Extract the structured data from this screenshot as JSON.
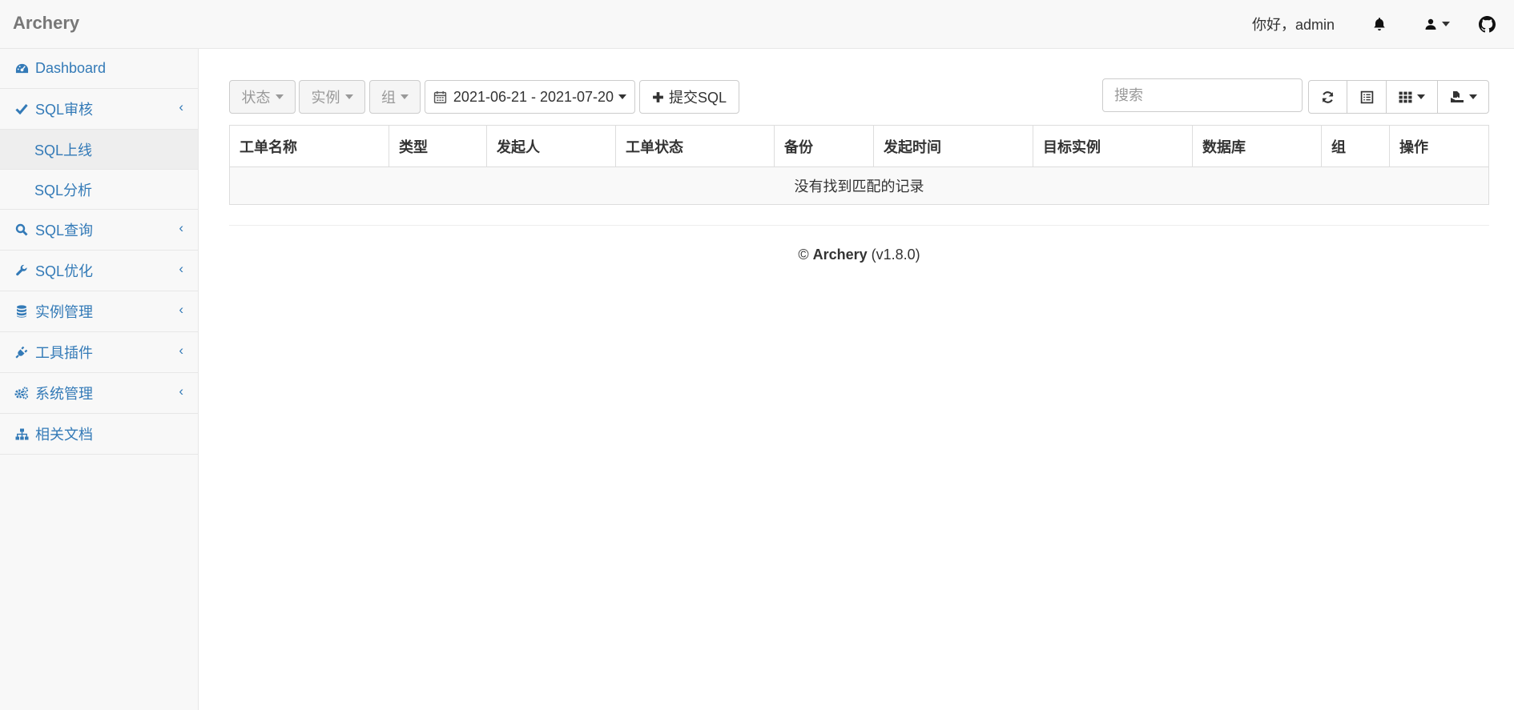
{
  "brand": "Archery",
  "header": {
    "greeting": "你好，admin"
  },
  "sidebar": {
    "items": [
      {
        "label": "Dashboard"
      },
      {
        "label": "SQL审核",
        "children": [
          {
            "label": "SQL上线"
          },
          {
            "label": "SQL分析"
          }
        ]
      },
      {
        "label": "SQL查询"
      },
      {
        "label": "SQL优化"
      },
      {
        "label": "实例管理"
      },
      {
        "label": "工具插件"
      },
      {
        "label": "系统管理"
      },
      {
        "label": "相关文档"
      }
    ]
  },
  "toolbar": {
    "status_filter": "状态",
    "instance_filter": "实例",
    "group_filter": "组",
    "date_range": "2021-06-21 - 2021-07-20",
    "submit_sql": "提交SQL",
    "search_placeholder": "搜索"
  },
  "table": {
    "columns": [
      "工单名称",
      "类型",
      "发起人",
      "工单状态",
      "备份",
      "发起时间",
      "目标实例",
      "数据库",
      "组",
      "操作"
    ],
    "empty_text": "没有找到匹配的记录"
  },
  "footer": {
    "copyright": "©",
    "brand": "Archery",
    "version": "(v1.8.0)"
  },
  "colors": {
    "link": "#337ab7",
    "navbar_bg": "#f8f8f8",
    "border": "#dddddd"
  }
}
